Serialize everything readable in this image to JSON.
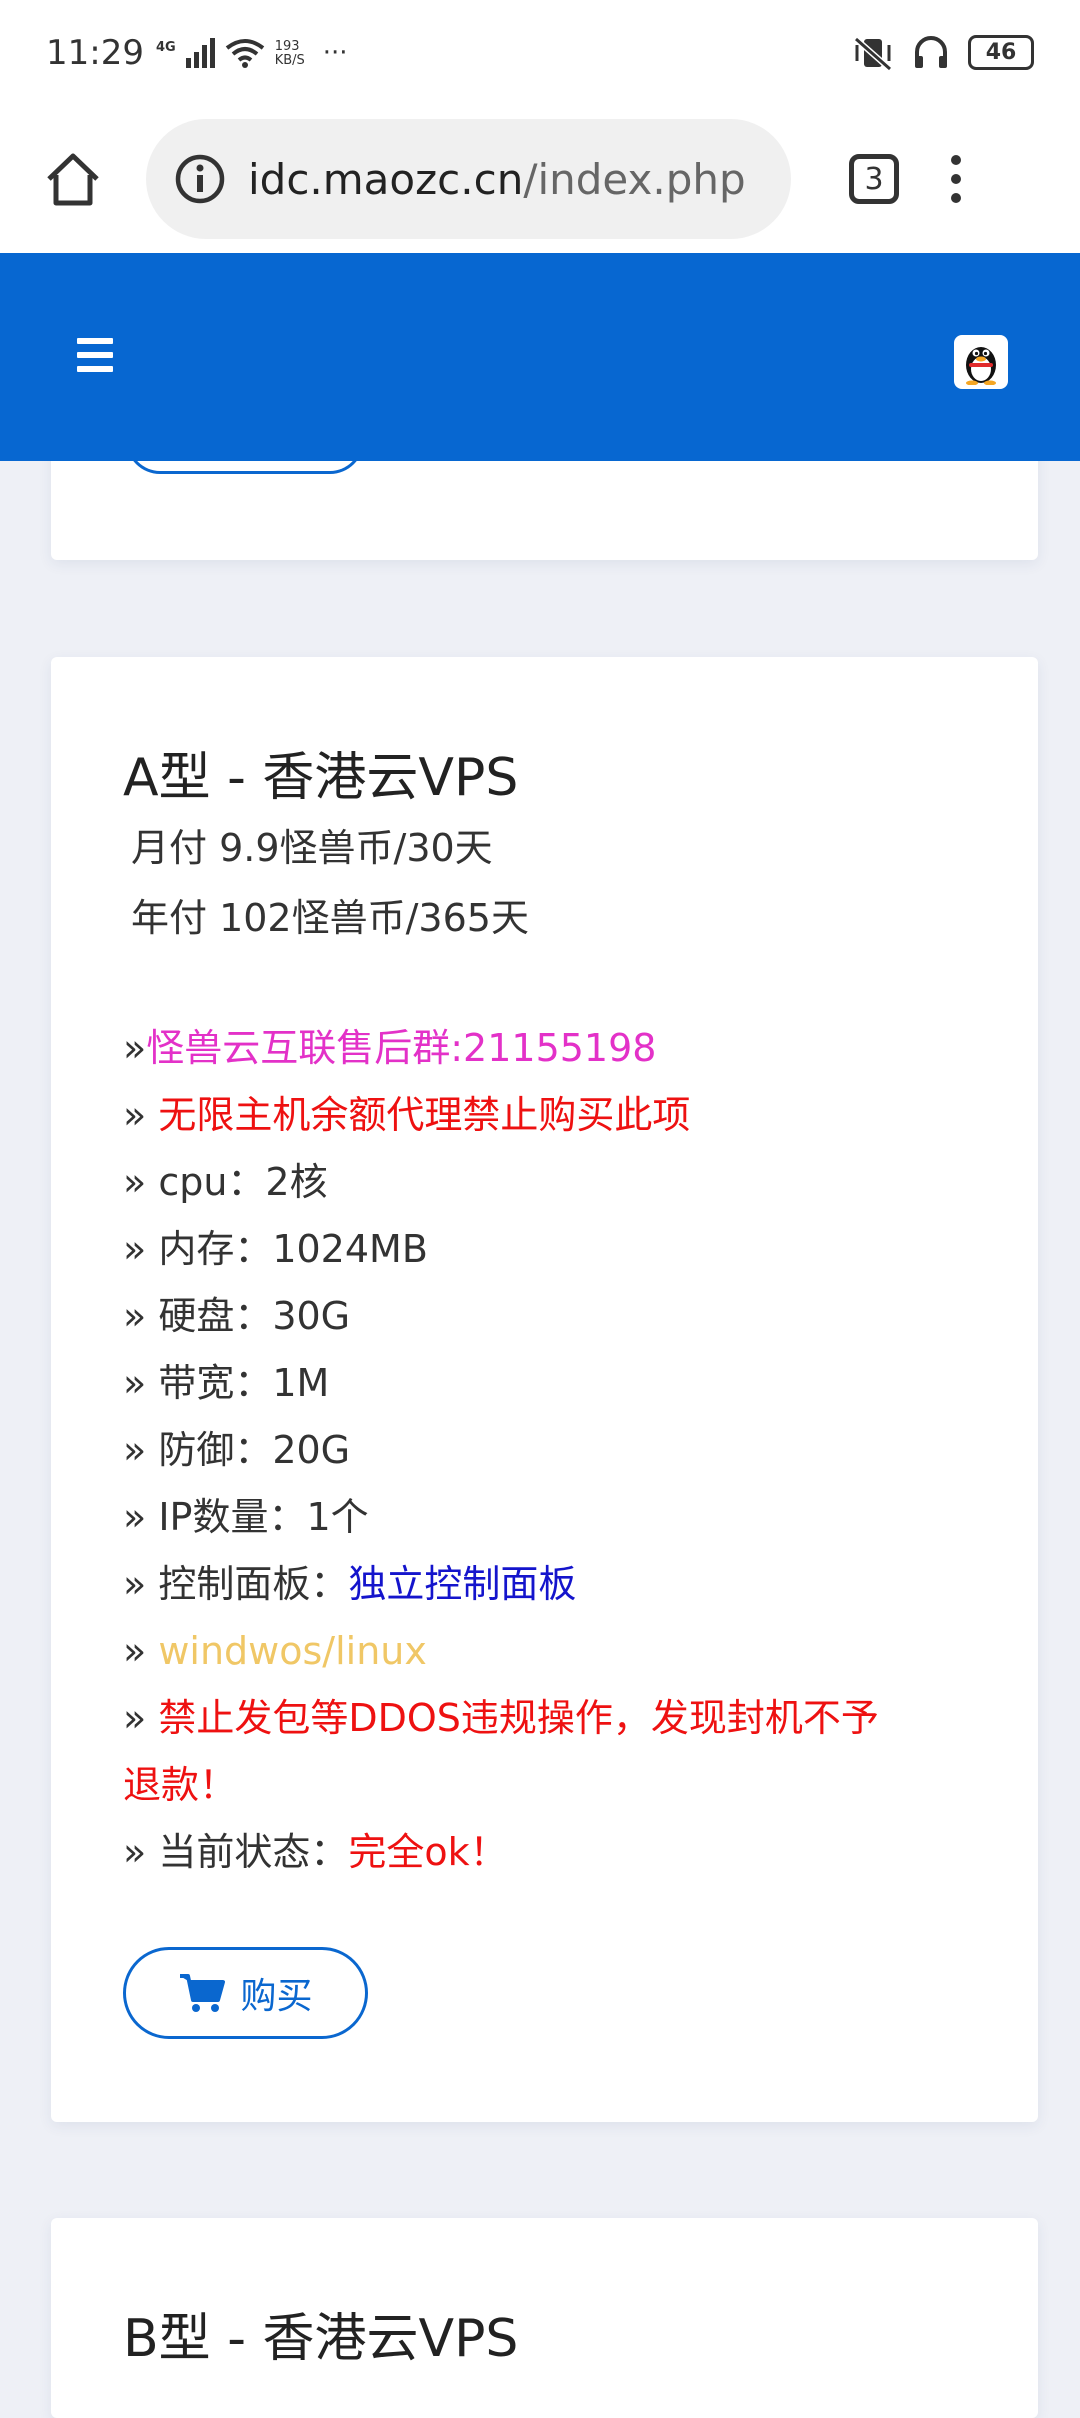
{
  "status_bar": {
    "time": "11:29",
    "network": "4G",
    "speed_value": "193",
    "speed_unit": "KB/S",
    "more": "···",
    "battery": "46"
  },
  "browser": {
    "url_domain": "idc.maozc.cn",
    "url_path": "/index.php",
    "tab_count": "3"
  },
  "product_a": {
    "title": "A型 - 香港云VPS",
    "monthly": "月付 9.9怪兽币/30天",
    "yearly": "年付 102怪兽币/365天",
    "features": [
      {
        "prefix": "»",
        "label": "",
        "value": "怪兽云互联售后群:21155198"
      },
      {
        "prefix": "» ",
        "label": "",
        "value": "无限主机余额代理禁止购买此项"
      },
      {
        "prefix": "» ",
        "label": "cpu：2核",
        "value": ""
      },
      {
        "prefix": "» ",
        "label": "内存：1024MB",
        "value": ""
      },
      {
        "prefix": "» ",
        "label": "硬盘：30G",
        "value": ""
      },
      {
        "prefix": "» ",
        "label": "带宽：1M",
        "value": ""
      },
      {
        "prefix": "» ",
        "label": "防御：20G",
        "value": ""
      },
      {
        "prefix": "» ",
        "label": "IP数量：1个",
        "value": ""
      },
      {
        "prefix": "» ",
        "label": "控制面板：",
        "value": "独立控制面板"
      },
      {
        "prefix": "» ",
        "label": "",
        "value": "windwos/linux"
      },
      {
        "prefix": "» ",
        "label": "",
        "value": "禁止发包等DDOS违规操作，发现封机不予"
      },
      {
        "prefix": "",
        "label": "",
        "value": "退款！"
      },
      {
        "prefix": "» ",
        "label": "当前状态：",
        "value": "完全ok！"
      }
    ],
    "buy_label": "购买"
  },
  "product_b": {
    "title": "B型 - 香港云VPS"
  },
  "colors": {
    "header_blue": "#0767d1",
    "accent_blue": "#0a67cf",
    "magenta": "#e331c8",
    "red": "#ee1111",
    "panel_blue": "#1414cc",
    "os_yellow": "#f0c766"
  }
}
